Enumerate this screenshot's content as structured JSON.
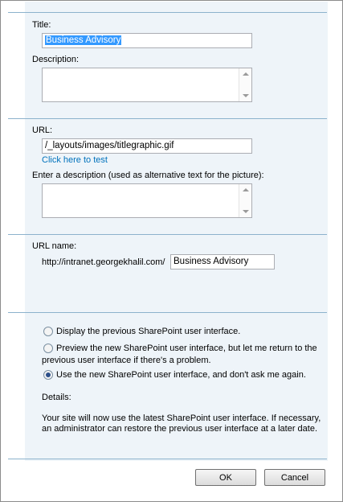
{
  "title_section": {
    "title_label": "Title:",
    "title_value": "Business Advisory",
    "description_label": "Description:",
    "description_value": ""
  },
  "url_section": {
    "url_label": "URL:",
    "url_value": "/_layouts/images/titlegraphic.gif",
    "test_link": "Click here to test",
    "alt_label": "Enter a description (used as alternative text for the picture):",
    "alt_value": ""
  },
  "url_name_section": {
    "label": "URL name:",
    "prefix": "http://intranet.georgekhalil.com/",
    "value": "Business Advisory"
  },
  "ui_version": {
    "options": [
      {
        "label": "Display the previous SharePoint user interface.",
        "selected": false
      },
      {
        "label_line1": "Preview the new SharePoint user interface, but let me return to the",
        "label_line2": "previous user interface if there's a problem.",
        "selected": false
      },
      {
        "label": "Use the new SharePoint user interface, and don't ask me again.",
        "selected": true
      }
    ],
    "details_label": "Details:",
    "details_text": "Your site will now use the latest SharePoint user interface. If necessary, an administrator can restore the previous user interface at a later date."
  },
  "buttons": {
    "ok": "OK",
    "cancel": "Cancel"
  }
}
